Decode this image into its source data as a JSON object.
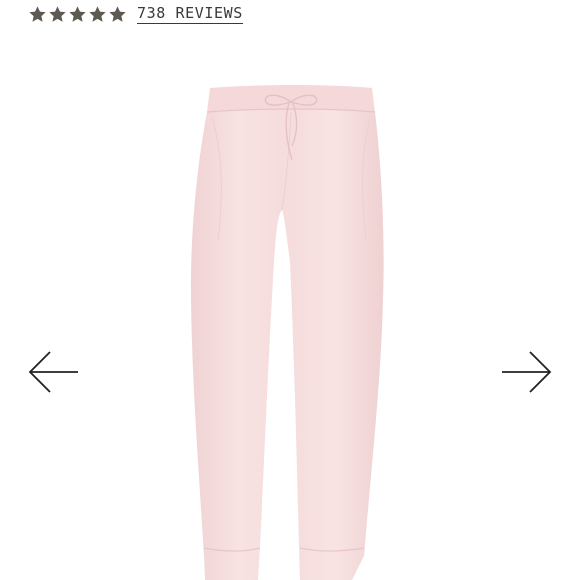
{
  "rating": {
    "stars": 5,
    "star_color": "#5e5a52",
    "reviews_label": "738 REVIEWS"
  },
  "gallery": {
    "product_color": "#f6dede",
    "prev_icon": "arrow-left-icon",
    "next_icon": "arrow-right-icon"
  }
}
